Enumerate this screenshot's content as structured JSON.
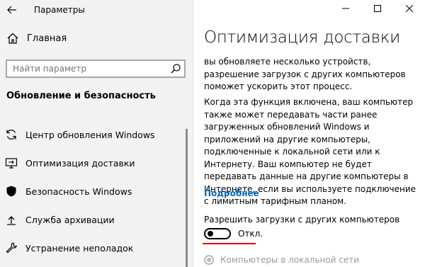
{
  "window": {
    "title": "Параметры"
  },
  "sidebar": {
    "home_label": "Главная",
    "search_placeholder": "Найти параметр",
    "section_title": "Обновление и безопасность",
    "items": [
      {
        "label": "Центр обновления Windows",
        "icon": "sync-icon"
      },
      {
        "label": "Оптимизация доставки",
        "icon": "delivery-optimization-icon"
      },
      {
        "label": "Безопасность Windows",
        "icon": "shield-icon"
      },
      {
        "label": "Служба архивации",
        "icon": "backup-icon"
      },
      {
        "label": "Устранение неполадок",
        "icon": "wrench-icon"
      }
    ]
  },
  "main": {
    "title": "Оптимизация доставки",
    "paragraph1": "вы обновляете несколько устройств, разрешение загрузок с других компьютеров поможет ускорить этот процесс.",
    "paragraph2": "Когда эта функция включена, ваш компьютер также может передавать части ранее загруженных обновлений Windows и приложений на другие компьютеры, подключенные к локальной сети или к Интернету. Ваш компьютер не будет передавать данные на другие компьютеры в Интернете, если вы используете подключение с лимитным тарифным планом.",
    "more_link": "Подробнее",
    "toggle_label": "Разрешить загрузки с других компьютеров",
    "toggle_state": "Откл.",
    "toggle_on": false,
    "radio_option": "Компьютеры в локальной сети"
  },
  "colors": {
    "accent_link": "#0067b8",
    "highlight": "#e00000",
    "sidebar_bg": "#f2f2f2"
  }
}
